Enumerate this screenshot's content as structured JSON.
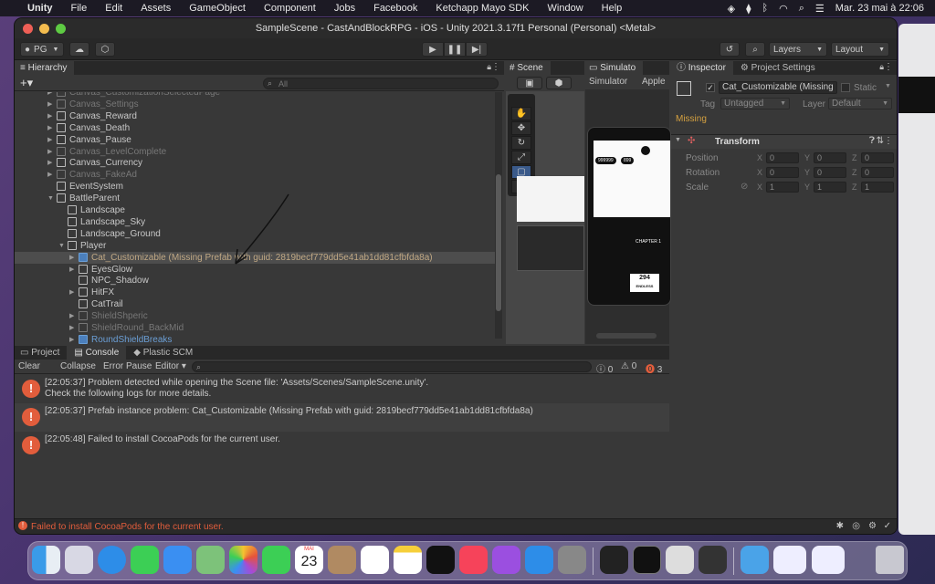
{
  "menubar": {
    "items": [
      "Unity",
      "File",
      "Edit",
      "Assets",
      "GameObject",
      "Component",
      "Jobs",
      "Facebook",
      "Ketchapp Mayo SDK",
      "Window",
      "Help"
    ],
    "clock": "Mar. 23 mai à  22:06"
  },
  "window": {
    "title": "SampleScene - CastAndBlockRPG - iOS - Unity 2021.3.17f1 Personal (Personal) <Metal>"
  },
  "toolbar": {
    "account": "PG",
    "layers": "Layers",
    "layout": "Layout"
  },
  "hierarchy": {
    "tab": "Hierarchy",
    "search_placeholder": "All",
    "rows": [
      {
        "label": "Canvas_CustomizationSelectedPage",
        "indent": 0,
        "style": "dim",
        "arrow": "▶"
      },
      {
        "label": "Canvas_Settings",
        "indent": 0,
        "style": "dim",
        "arrow": "▶"
      },
      {
        "label": "Canvas_Reward",
        "indent": 0,
        "style": "",
        "arrow": "▶"
      },
      {
        "label": "Canvas_Death",
        "indent": 0,
        "style": "",
        "arrow": "▶"
      },
      {
        "label": "Canvas_Pause",
        "indent": 0,
        "style": "",
        "arrow": "▶"
      },
      {
        "label": "Canvas_LevelComplete",
        "indent": 0,
        "style": "dim",
        "arrow": "▶"
      },
      {
        "label": "Canvas_Currency",
        "indent": 0,
        "style": "",
        "arrow": "▶"
      },
      {
        "label": "Canvas_FakeAd",
        "indent": 0,
        "style": "dim",
        "arrow": "▶"
      },
      {
        "label": "EventSystem",
        "indent": 0,
        "style": "",
        "arrow": ""
      },
      {
        "label": "BattleParent",
        "indent": 0,
        "style": "",
        "arrow": "▼"
      },
      {
        "label": "Landscape",
        "indent": 1,
        "style": "",
        "arrow": ""
      },
      {
        "label": "Landscape_Sky",
        "indent": 1,
        "style": "",
        "arrow": ""
      },
      {
        "label": "Landscape_Ground",
        "indent": 1,
        "style": "",
        "arrow": ""
      },
      {
        "label": "Player",
        "indent": 1,
        "style": "",
        "arrow": "▼"
      },
      {
        "label": "Cat_Customizable (Missing Prefab with guid: 2819becf779dd5e41ab1dd81cfbfda8a)",
        "indent": 2,
        "style": "missing sel",
        "arrow": "▶"
      },
      {
        "label": "EyesGlow",
        "indent": 2,
        "style": "",
        "arrow": "▶"
      },
      {
        "label": "NPC_Shadow",
        "indent": 2,
        "style": "",
        "arrow": ""
      },
      {
        "label": "HitFX",
        "indent": 2,
        "style": "",
        "arrow": "▶"
      },
      {
        "label": "CatTrail",
        "indent": 2,
        "style": "",
        "arrow": ""
      },
      {
        "label": "ShieldShperic",
        "indent": 2,
        "style": "dim",
        "arrow": "▶"
      },
      {
        "label": "ShieldRound_BackMid",
        "indent": 2,
        "style": "dim",
        "arrow": "▶"
      },
      {
        "label": "RoundShieldBreaks",
        "indent": 2,
        "style": "blue",
        "arrow": "▶"
      }
    ]
  },
  "scene": {
    "tab": "Scene"
  },
  "simulator": {
    "tab": "Simulato",
    "mode": "Simulator",
    "device": "Apple"
  },
  "game_view": {
    "score_left": "999999",
    "score_right": "899",
    "chapter": "CHAPTER 1",
    "endless_value": "294",
    "endless_label": "ENDLESS"
  },
  "inspector": {
    "tab": "Inspector",
    "tab2": "Project Settings",
    "object_name": "Cat_Customizable (Missing",
    "static_label": "Static",
    "tag_label": "Tag",
    "tag_value": "Untagged",
    "layer_label": "Layer",
    "layer_value": "Default",
    "missing": "Missing",
    "component": "Transform",
    "props": [
      {
        "name": "Position",
        "x": "0",
        "y": "0",
        "z": "0"
      },
      {
        "name": "Rotation",
        "x": "0",
        "y": "0",
        "z": "0"
      },
      {
        "name": "Scale",
        "x": "1",
        "y": "1",
        "z": "1"
      }
    ]
  },
  "console": {
    "tabs": [
      "Project",
      "Console",
      "Plastic SCM"
    ],
    "buttons": [
      "Clear",
      "Collapse",
      "Error Pause",
      "Editor"
    ],
    "counts": {
      "info": "0",
      "warn": "0",
      "error": "3"
    },
    "logs": [
      {
        "line1": "[22:05:37] Problem detected while opening the Scene file: 'Assets/Scenes/SampleScene.unity'.",
        "line2": "Check the following logs for more details."
      },
      {
        "line1": "[22:05:37] Prefab instance problem: Cat_Customizable (Missing Prefab with guid: 2819becf779dd5e41ab1dd81cfbfda8a)",
        "line2": ""
      },
      {
        "line1": "[22:05:48] Failed to install CocoaPods for the current user.",
        "line2": ""
      }
    ]
  },
  "statusbar": {
    "message": "Failed to install CocoaPods for the current user."
  },
  "dock": {
    "calendar_month": "MAI",
    "calendar_day": "23"
  },
  "colors": {
    "error": "#e25d3c",
    "accent": "#6b9fd6",
    "missing_text": "#d4a040"
  }
}
